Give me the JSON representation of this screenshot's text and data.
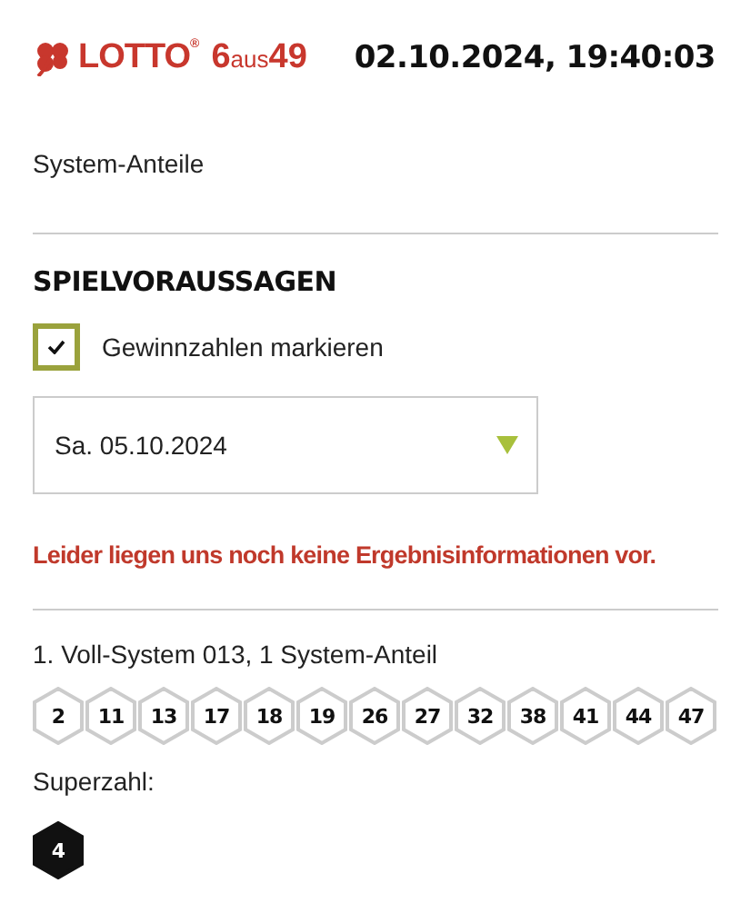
{
  "header": {
    "logo": {
      "brand": "LOTTO",
      "registered": "®",
      "game": [
        "6",
        "aus",
        "49"
      ]
    },
    "timestamp": "02.10.2024, 19:40:03"
  },
  "section_label": "System-Anteile",
  "predictions": {
    "title": "SPIELVORAUSSAGEN",
    "mark_winning": {
      "label": "Gewinnzahlen markieren",
      "checked": true
    },
    "draw_date": {
      "value": "Sa. 05.10.2024"
    },
    "message": "Leider liegen uns noch keine Ergebnisinformationen vor."
  },
  "tickets": [
    {
      "title": "1. Voll-System 013, 1 System-Anteil",
      "numbers": [
        "2",
        "11",
        "13",
        "17",
        "18",
        "19",
        "26",
        "27",
        "32",
        "38",
        "41",
        "44",
        "47"
      ],
      "superzahl_label": "Superzahl:",
      "superzahl": "4"
    }
  ]
}
